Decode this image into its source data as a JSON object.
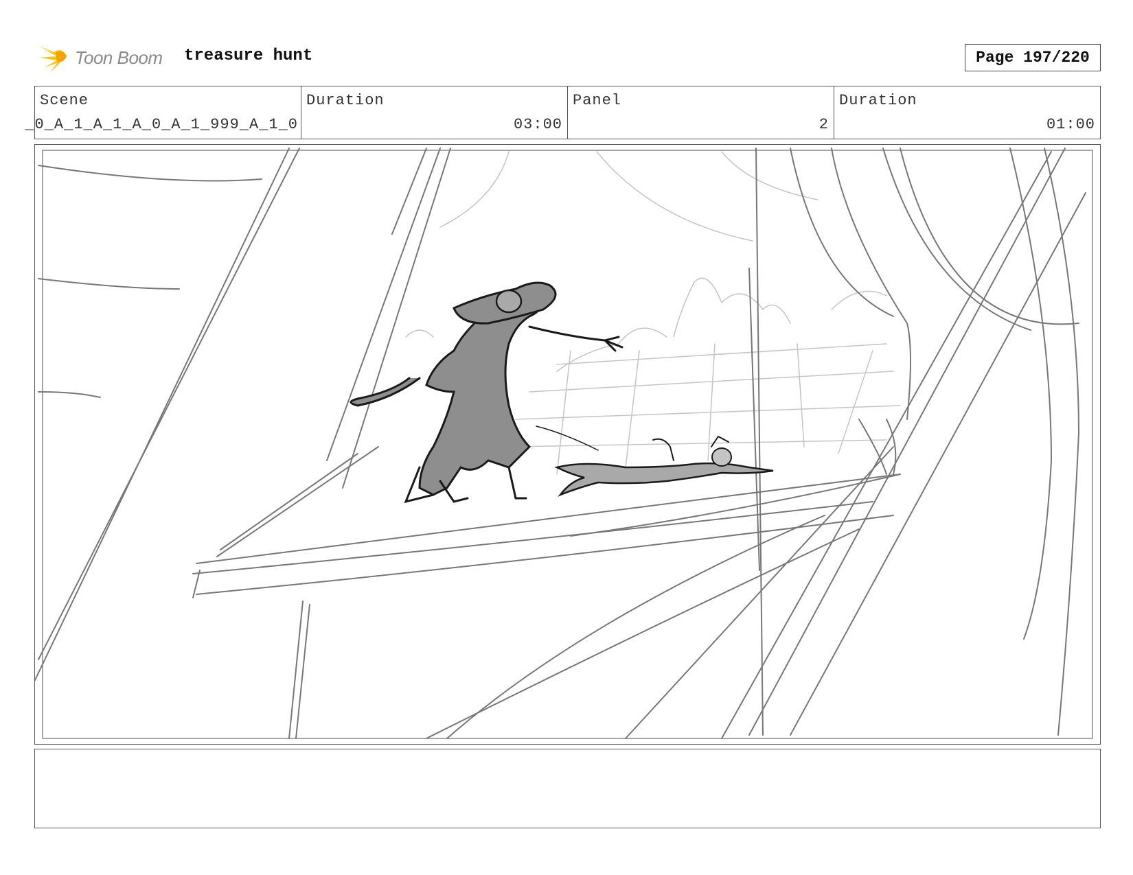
{
  "header": {
    "logo_text": "Toon Boom",
    "project_title": "treasure hunt",
    "page_label": "Page 197/220"
  },
  "info": {
    "scene_label": "Scene",
    "scene_value": "_0_A_1_A_1_A_0_A_1_999_A_1_0",
    "scene_duration_label": "Duration",
    "scene_duration_value": "03:00",
    "panel_label": "Panel",
    "panel_value": "2",
    "panel_duration_label": "Duration",
    "panel_duration_value": "01:00"
  },
  "colors": {
    "logo_star": "#f5c518",
    "logo_text": "#8a8a8a",
    "sketch_dark": "#1a1a1a",
    "sketch_mid": "#777777",
    "sketch_light": "#c4c4c4",
    "character_fill": "#8e8e8e",
    "border": "#555555"
  },
  "notes": {
    "text": ""
  }
}
